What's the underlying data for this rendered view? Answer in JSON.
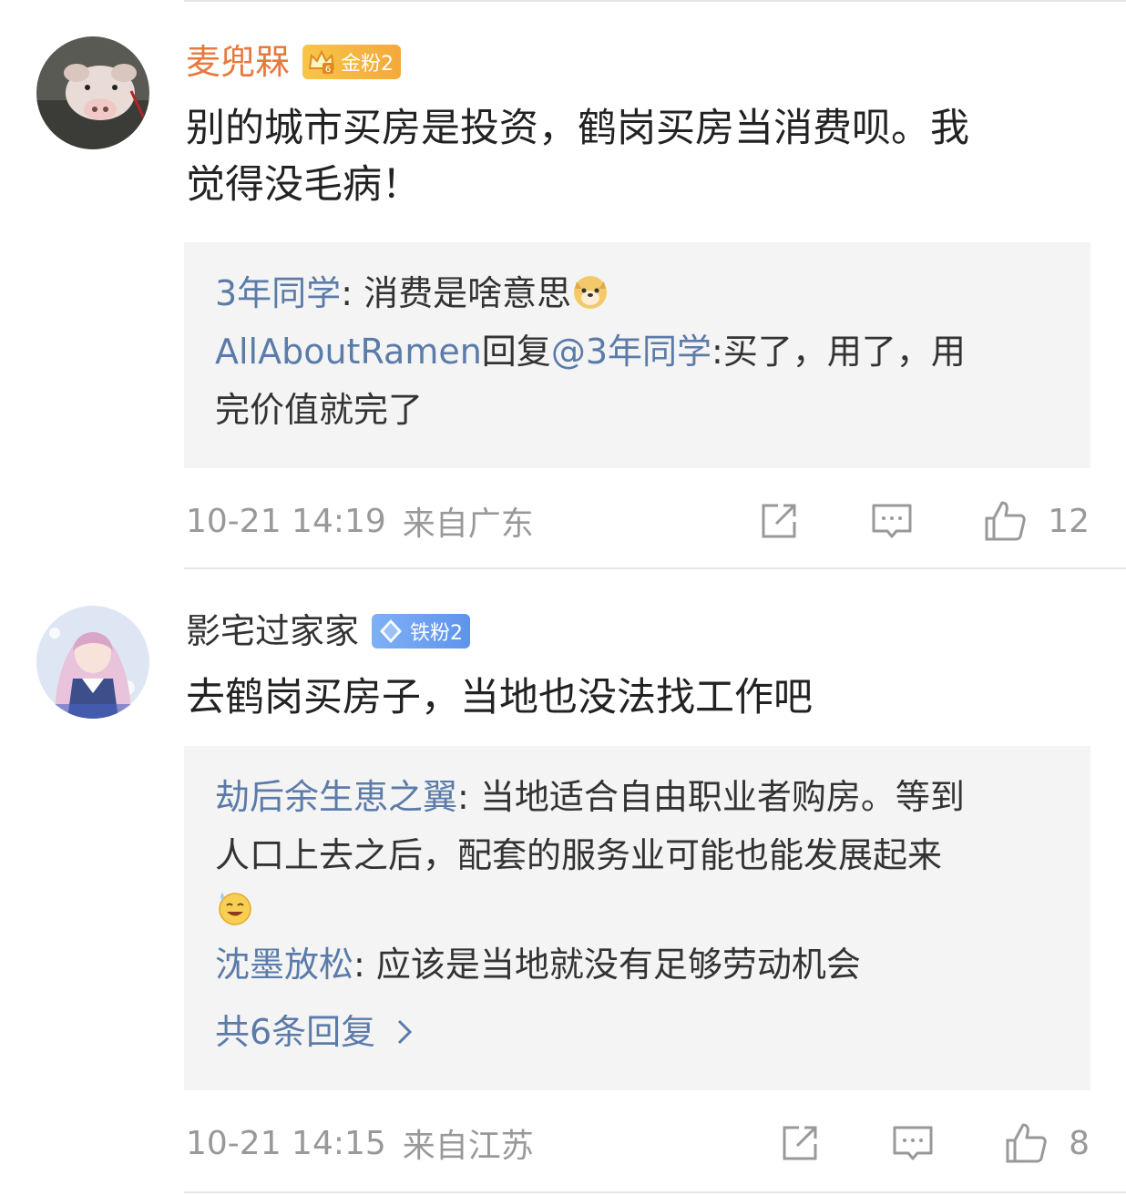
{
  "comments": [
    {
      "author": "麦兜槑",
      "badge": "金粉2",
      "text_lines": [
        "别的城市买房是投资，鹤岗买房当消费呗。我",
        "觉得没毛病！"
      ],
      "replies": [
        {
          "user": "3年同学",
          "sep": ": ",
          "text": "消费是啥意思",
          "emoji": "doge-emoji"
        },
        {
          "user": "AllAboutRamen",
          "mid": "回复",
          "target": "@3年同学",
          "sep": ":",
          "text": "买了，用了，用",
          "text2": "完价值就完了"
        }
      ],
      "time": "10-21 14:19",
      "location": "来自广东",
      "likes": "12"
    },
    {
      "author": "影宅过家家",
      "badge": "铁粉2",
      "text_lines": [
        "去鹤岗买房子，当地也没法找工作吧"
      ],
      "replies": [
        {
          "user": "劫后余生恵之翼",
          "sep": ": ",
          "text": "当地适合自由职业者购房。等到",
          "text2": "人口上去之后，配套的服务业可能也能发展起来",
          "emoji": "sweat-smile-emoji"
        },
        {
          "user": "沈墨放松",
          "sep": ": ",
          "text": "应该是当地就没有足够劳动机会"
        }
      ],
      "more_replies": "共6条回复",
      "time": "10-21 14:15",
      "location": "来自江苏",
      "likes": "8"
    }
  ],
  "colors": {
    "gold_name": "#e8793d",
    "link_blue": "#5b7ba8",
    "meta_gray": "#999999",
    "reply_bg": "#f4f4f4"
  }
}
